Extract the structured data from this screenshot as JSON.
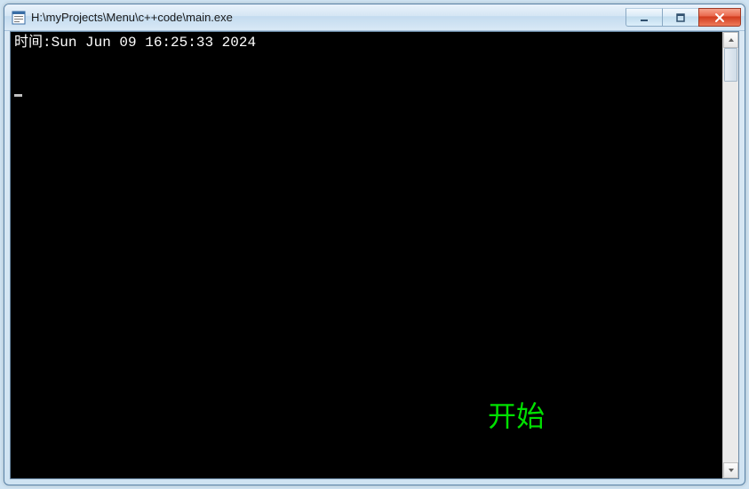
{
  "window": {
    "title": "H:\\myProjects\\Menu\\c++code\\main.exe"
  },
  "console": {
    "time_label": "时间:",
    "time_value": "Sun Jun 09 16:25:33 2024",
    "start_label": "开始"
  }
}
